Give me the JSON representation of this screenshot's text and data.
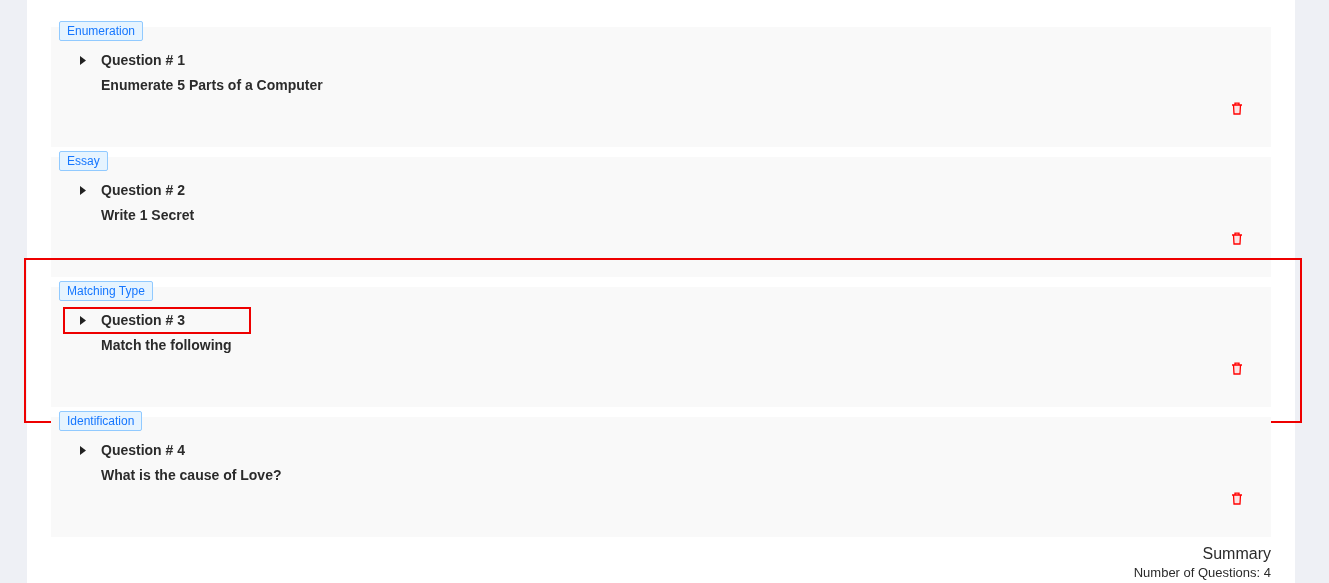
{
  "questions": [
    {
      "type": "Enumeration",
      "title": "Question # 1",
      "text": "Enumerate 5 Parts of a Computer",
      "highlighted": false,
      "title_highlighted": false
    },
    {
      "type": "Essay",
      "title": "Question # 2",
      "text": "Write 1 Secret",
      "highlighted": false,
      "title_highlighted": false
    },
    {
      "type": "Matching Type",
      "title": "Question # 3",
      "text": "Match the following",
      "highlighted": true,
      "title_highlighted": true
    },
    {
      "type": "Identification",
      "title": "Question # 4",
      "text": "What is the cause of Love?",
      "highlighted": false,
      "title_highlighted": false
    }
  ],
  "summary": {
    "title": "Summary",
    "count": "Number of Questions: 4"
  }
}
